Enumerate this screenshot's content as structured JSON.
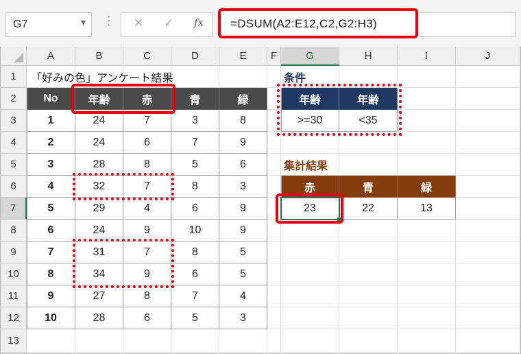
{
  "namebox": {
    "value": "G7"
  },
  "formula": {
    "value": "=DSUM(A2:E12,C2,G2:H3)"
  },
  "icons": {
    "cancel": "✕",
    "confirm": "✓",
    "fx": "fx"
  },
  "columns": [
    "A",
    "B",
    "C",
    "D",
    "E",
    "F",
    "G",
    "H",
    "I",
    "J"
  ],
  "rows": [
    "1",
    "2",
    "3",
    "4",
    "5",
    "6",
    "7",
    "8",
    "9",
    "10",
    "11",
    "12",
    "13"
  ],
  "sheet": {
    "title": "「好みの色」アンケート結果",
    "headers": [
      "No",
      "年齢",
      "赤",
      "青",
      "緑"
    ],
    "data": [
      [
        "1",
        "24",
        "7",
        "3",
        "8"
      ],
      [
        "2",
        "24",
        "6",
        "7",
        "9"
      ],
      [
        "3",
        "28",
        "8",
        "5",
        "6"
      ],
      [
        "4",
        "32",
        "7",
        "8",
        "3"
      ],
      [
        "5",
        "29",
        "4",
        "6",
        "9"
      ],
      [
        "6",
        "24",
        "9",
        "10",
        "9"
      ],
      [
        "7",
        "31",
        "7",
        "8",
        "5"
      ],
      [
        "8",
        "34",
        "9",
        "6",
        "5"
      ],
      [
        "9",
        "27",
        "8",
        "7",
        "4"
      ],
      [
        "10",
        "28",
        "6",
        "5",
        "3"
      ]
    ]
  },
  "criteria": {
    "label": "条件",
    "headers": [
      "年齢",
      "年齢"
    ],
    "values": [
      ">=30",
      "<35"
    ]
  },
  "summary": {
    "label": "集計結果",
    "headers": [
      "赤",
      "青",
      "緑"
    ],
    "values": [
      "23",
      "22",
      "13"
    ]
  },
  "colors": {
    "highlight": "#e60012",
    "header_dark": "#4a4a4a",
    "header_navy": "#1f3864",
    "header_brown": "#843c0c",
    "selection": "#217346"
  }
}
